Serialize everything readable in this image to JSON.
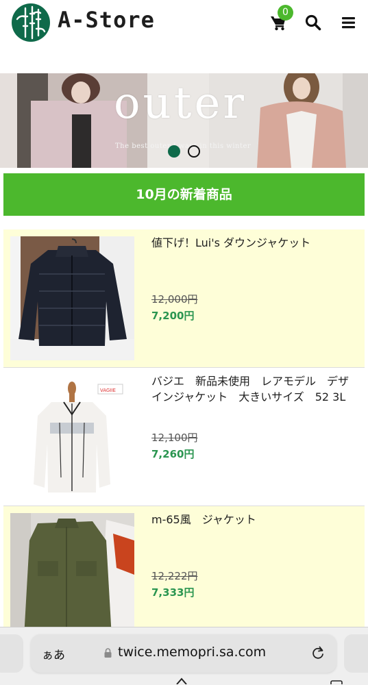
{
  "header": {
    "brand": "A-Store",
    "cart_count": "0",
    "icons": [
      "cart-icon",
      "search-icon",
      "menu-icon"
    ],
    "colors": {
      "accent": "#4cb82d",
      "logo": "#0f6a4a"
    }
  },
  "banner": {
    "title": "outer",
    "subtitle": "The best outer I want in this winter",
    "slides_total": 2,
    "active_slide": 1
  },
  "section": {
    "title": "10月の新着商品"
  },
  "products": [
    {
      "name": "値下げ！Lui's ダウンジャケット",
      "old_price": "12,000円",
      "new_price": "7,200円"
    },
    {
      "name": "バジエ　新品未使用　レアモデル　デザインジャケット　大きいサイズ　52 3L",
      "old_price": "12,100円",
      "new_price": "7,260円"
    },
    {
      "name": "m-65風　ジャケット",
      "old_price": "12,222円",
      "new_price": "7,333円"
    }
  ],
  "browser": {
    "aa_label": "ぁあ",
    "url": "twice.memopri.sa.com"
  }
}
